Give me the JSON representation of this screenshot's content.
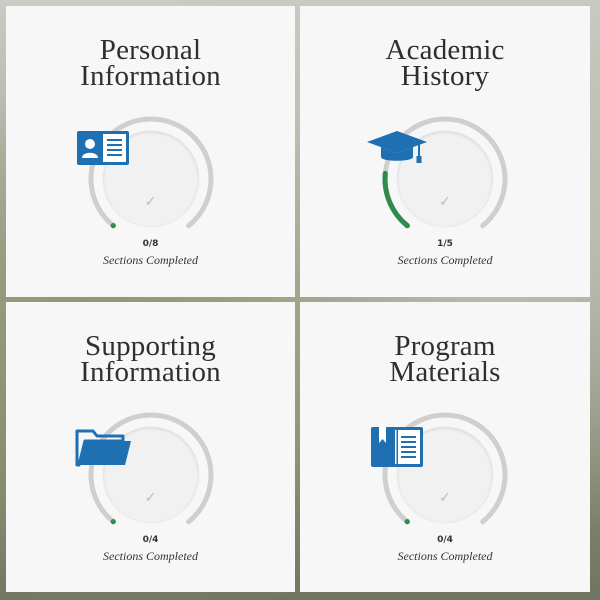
{
  "colors": {
    "accent": "#1f6fb3",
    "progress": "#2e8b4c",
    "track": "#cfcfcf",
    "card": "#f7f7f7",
    "text": "#2f2f2f"
  },
  "cards": [
    {
      "title_line1": "Personal",
      "title_line2": "Information",
      "icon": "id-card-icon",
      "completed": 0,
      "total": 8,
      "count_text": "0/8",
      "caption": "Sections Completed"
    },
    {
      "title_line1": "Academic",
      "title_line2": "History",
      "icon": "graduation-cap-icon",
      "completed": 1,
      "total": 5,
      "count_text": "1/5",
      "caption": "Sections Completed"
    },
    {
      "title_line1": "Supporting",
      "title_line2": "Information",
      "icon": "folder-icon",
      "completed": 0,
      "total": 4,
      "count_text": "0/4",
      "caption": "Sections Completed"
    },
    {
      "title_line1": "Program",
      "title_line2": "Materials",
      "icon": "book-icon",
      "completed": 0,
      "total": 4,
      "count_text": "0/4",
      "caption": "Sections Completed"
    }
  ]
}
